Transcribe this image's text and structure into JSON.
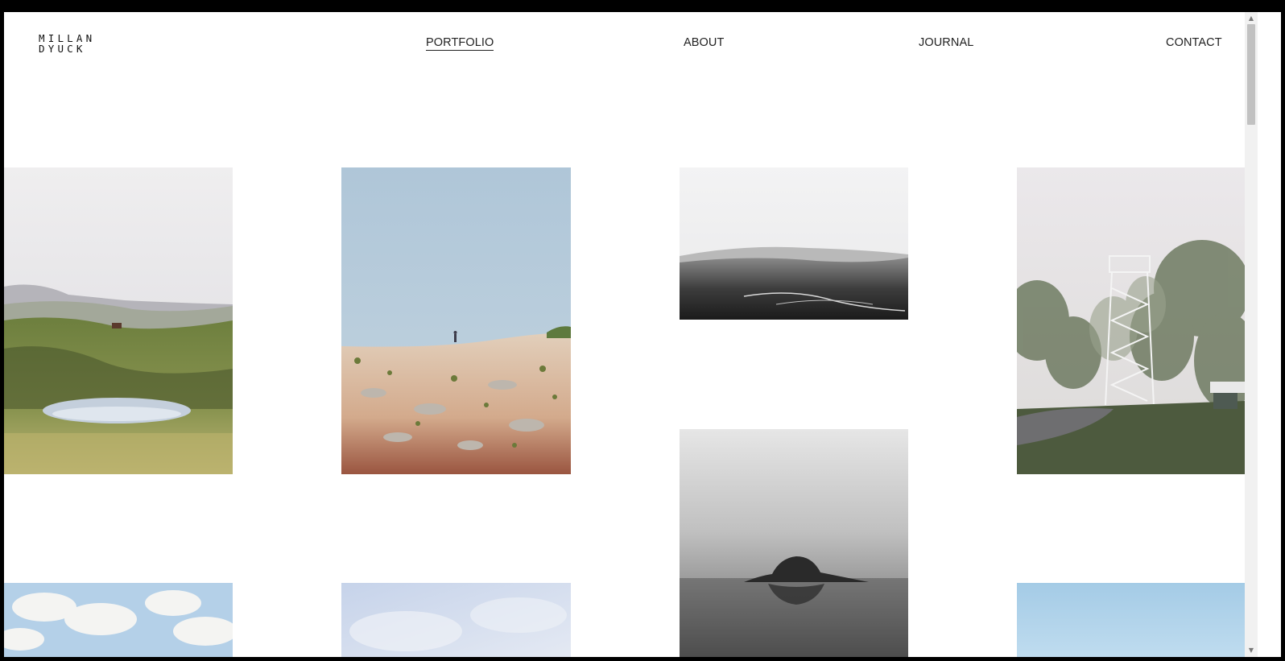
{
  "brand": {
    "line1": "MILLAN",
    "line2": "DYUCK"
  },
  "nav": {
    "items": [
      {
        "label": "PORTFOLIO",
        "active": true
      },
      {
        "label": "ABOUT",
        "active": false
      },
      {
        "label": "JOURNAL",
        "active": false
      },
      {
        "label": "CONTACT",
        "active": false
      }
    ]
  },
  "gallery": {
    "photos": [
      {
        "name": "meadow-pond-photo",
        "palette": [
          "#ecebec",
          "#7b8d4d",
          "#b9b46c"
        ]
      },
      {
        "name": "desert-hiker-photo",
        "palette": [
          "#b4cadb",
          "#d9c0a6",
          "#9e5a43"
        ]
      },
      {
        "name": "misty-valley-photo",
        "palette": [
          "#f2f2f3",
          "#9d9d9d",
          "#1f1f1f"
        ]
      },
      {
        "name": "lookout-tower-photo",
        "palette": [
          "#eae7ea",
          "#6d7a5e",
          "#4a4f41"
        ]
      },
      {
        "name": "foggy-rock-photo",
        "palette": [
          "#e4e4e4",
          "#b0b0b0",
          "#2f2f2f"
        ]
      },
      {
        "name": "cloudy-sky-photo",
        "palette": [
          "#b7d3ea",
          "#ffffff"
        ]
      },
      {
        "name": "hazy-blue-photo",
        "palette": [
          "#c9d6ea",
          "#e3e9f3"
        ]
      },
      {
        "name": "pale-blue-sky-photo",
        "palette": [
          "#a6cde7",
          "#bcdbee"
        ]
      }
    ]
  }
}
